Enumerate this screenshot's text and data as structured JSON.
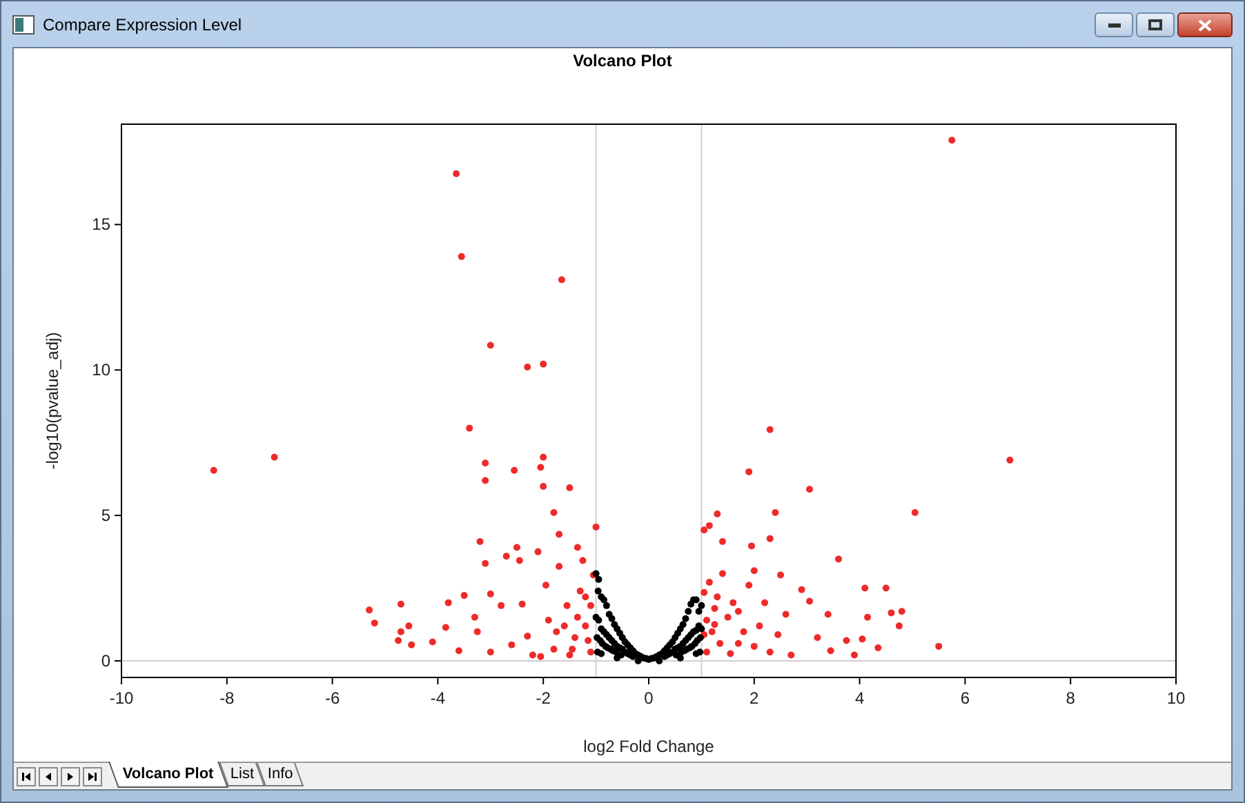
{
  "window": {
    "title": "Compare Expression Level"
  },
  "plot": {
    "title": "Volcano Plot",
    "chart_data": {
      "type": "scatter",
      "xlabel": "log2 Fold Change",
      "ylabel": "-log10(pvalue_adj)",
      "xlim": [
        -10,
        10
      ],
      "ylim": [
        -0.57,
        18.45
      ],
      "xticks": [
        -10,
        -8,
        -6,
        -4,
        -2,
        0,
        2,
        4,
        6,
        8,
        10
      ],
      "yticks": [
        0,
        5,
        10,
        15
      ],
      "ref_lines": [
        {
          "axis": "x",
          "value": -1
        },
        {
          "axis": "x",
          "value": 1
        },
        {
          "axis": "y",
          "value": 0
        }
      ],
      "series": [
        {
          "color": "#ee2a2a",
          "x": [
            -8.25,
            -7.1,
            -3.65,
            -3.55,
            -1.65,
            -3.0,
            -2.3,
            -2.0,
            -3.4,
            -3.1,
            -3.1,
            -2.55,
            -2.0,
            -2.05,
            -2.0,
            -1.5,
            -1.8,
            -1.0,
            -3.2,
            -1.7,
            -2.5,
            -1.35,
            -5.3,
            -5.2,
            -4.7,
            -4.7,
            -4.55,
            -4.5,
            -4.75,
            -4.1,
            -3.85,
            -3.8,
            -3.6,
            -3.5,
            -3.3,
            -3.25,
            -3.1,
            -3.0,
            -2.8,
            -2.7,
            -2.45,
            -2.4,
            -2.3,
            -2.2,
            -2.1,
            -1.95,
            -1.9,
            -1.8,
            -1.7,
            -1.55,
            -1.4,
            -1.3,
            -1.2,
            -1.1,
            -1.05,
            -2.6,
            -3.0,
            -1.5,
            -1.25,
            -1.6,
            -1.15,
            -1.35,
            -1.45,
            -1.1,
            -1.2,
            -1.75,
            -2.05,
            5.75,
            6.85,
            2.3,
            1.9,
            3.05,
            5.05,
            2.4,
            1.3,
            1.15,
            1.05,
            2.3,
            1.4,
            1.95,
            3.6,
            2.5,
            1.05,
            1.3,
            4.1,
            4.5,
            2.9,
            3.05,
            4.15,
            4.6,
            4.8,
            4.75,
            3.4,
            5.5,
            3.75,
            3.9,
            4.35,
            4.05,
            1.2,
            1.5,
            1.7,
            1.9,
            2.1,
            2.3,
            2.6,
            2.7,
            3.2,
            1.1,
            1.4,
            2.0,
            1.6,
            2.2,
            1.25,
            3.45,
            2.45,
            1.1,
            1.35,
            1.8,
            1.15,
            1.55,
            2.0,
            1.05,
            1.25,
            1.7
          ],
          "values": [
            6.55,
            7.0,
            16.75,
            13.9,
            13.1,
            10.85,
            10.1,
            10.2,
            8.0,
            6.8,
            6.2,
            6.55,
            7.0,
            6.65,
            6.0,
            5.95,
            5.1,
            4.6,
            4.1,
            4.35,
            3.9,
            3.9,
            1.75,
            1.3,
            1.95,
            1.0,
            1.2,
            0.55,
            0.7,
            0.65,
            1.15,
            2.0,
            0.35,
            2.25,
            1.5,
            1.0,
            3.35,
            0.3,
            1.9,
            3.6,
            3.45,
            1.95,
            0.85,
            0.2,
            3.75,
            2.6,
            1.4,
            0.4,
            3.25,
            1.9,
            0.8,
            2.4,
            1.2,
            0.3,
            2.95,
            0.55,
            2.3,
            0.2,
            3.45,
            1.2,
            0.7,
            1.5,
            0.4,
            1.9,
            2.2,
            1.0,
            0.15,
            17.9,
            6.9,
            7.95,
            6.5,
            5.9,
            5.1,
            5.1,
            5.05,
            4.65,
            4.5,
            4.2,
            4.1,
            3.95,
            3.5,
            2.95,
            2.35,
            2.2,
            2.5,
            2.5,
            2.45,
            2.05,
            1.5,
            1.65,
            1.7,
            1.2,
            1.6,
            0.5,
            0.7,
            0.2,
            0.45,
            0.75,
            1.0,
            1.5,
            0.6,
            2.6,
            1.2,
            0.3,
            1.6,
            0.2,
            0.8,
            0.3,
            3.0,
            3.1,
            2.0,
            2.0,
            1.8,
            0.35,
            0.9,
            1.4,
            0.6,
            1.0,
            2.7,
            0.25,
            0.5,
            0.9,
            1.25,
            1.7
          ]
        },
        {
          "color": "#000000",
          "x": [
            -1.0,
            -0.95,
            -0.9,
            -0.85,
            -0.8,
            -0.75,
            -0.7,
            -0.65,
            -0.6,
            -0.55,
            -0.5,
            -0.45,
            -0.4,
            -0.35,
            -0.3,
            -0.25,
            -0.2,
            -0.15,
            -0.1,
            -0.05,
            0.0,
            0.05,
            0.1,
            0.15,
            0.2,
            0.25,
            0.3,
            0.35,
            0.4,
            0.45,
            0.5,
            0.55,
            0.6,
            0.65,
            0.7,
            0.75,
            0.8,
            0.85,
            0.9,
            0.95,
            1.0,
            -1.0,
            -0.95,
            -0.9,
            -0.85,
            -0.8,
            -0.75,
            -0.7,
            -0.65,
            -0.6,
            -0.55,
            -0.5,
            -0.45,
            -0.4,
            -0.35,
            -0.3,
            0.3,
            0.35,
            0.4,
            0.45,
            0.5,
            0.55,
            0.6,
            0.65,
            0.7,
            0.75,
            0.8,
            0.85,
            0.9,
            0.95,
            1.0,
            -0.98,
            -0.92,
            -0.88,
            -0.82,
            -0.78,
            -0.72,
            -0.68,
            -0.62,
            -0.52,
            0.52,
            0.62,
            0.68,
            0.72,
            0.78,
            0.82,
            0.88,
            0.92,
            0.98,
            -0.97,
            -0.9,
            -0.6,
            -0.2,
            0.2,
            0.6,
            0.9,
            0.97,
            -0.96
          ],
          "values": [
            3.0,
            2.8,
            2.2,
            2.1,
            1.9,
            1.6,
            1.45,
            1.25,
            1.1,
            0.95,
            0.8,
            0.65,
            0.55,
            0.45,
            0.35,
            0.25,
            0.2,
            0.15,
            0.1,
            0.08,
            0.05,
            0.08,
            0.1,
            0.15,
            0.2,
            0.25,
            0.35,
            0.45,
            0.55,
            0.65,
            0.8,
            0.95,
            1.1,
            1.25,
            1.45,
            1.7,
            1.95,
            2.1,
            2.1,
            1.7,
            1.9,
            1.5,
            1.4,
            1.1,
            1.0,
            0.9,
            0.8,
            0.7,
            0.6,
            0.5,
            0.45,
            0.4,
            0.3,
            0.25,
            0.2,
            0.15,
            0.15,
            0.2,
            0.25,
            0.3,
            0.4,
            0.45,
            0.5,
            0.6,
            0.7,
            0.8,
            0.9,
            1.0,
            1.05,
            1.2,
            1.1,
            0.8,
            0.7,
            0.6,
            0.5,
            0.45,
            0.4,
            0.35,
            0.3,
            0.2,
            0.2,
            0.3,
            0.35,
            0.4,
            0.45,
            0.5,
            0.6,
            0.7,
            0.8,
            0.3,
            0.25,
            0.1,
            0.0,
            0.0,
            0.1,
            0.25,
            0.3,
            2.4
          ]
        }
      ]
    }
  },
  "tabs": [
    {
      "label": "Volcano Plot",
      "selected": true
    },
    {
      "label": "List",
      "selected": false
    },
    {
      "label": "Info",
      "selected": false
    }
  ]
}
